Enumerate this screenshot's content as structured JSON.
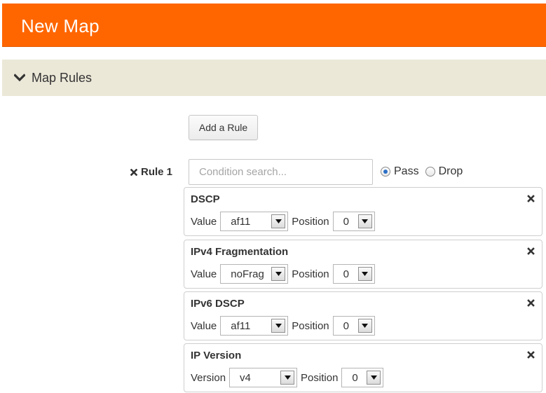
{
  "header": {
    "title": "New Map"
  },
  "section": {
    "title": "Map Rules",
    "chevron_icon": "chevron-down-icon"
  },
  "add_rule_button": "Add a Rule",
  "rule": {
    "label": "Rule 1",
    "condition_search": {
      "placeholder": "Condition search...",
      "value": ""
    },
    "action_options": [
      {
        "label": "Pass",
        "selected": true
      },
      {
        "label": "Drop",
        "selected": false
      }
    ]
  },
  "conditions": [
    {
      "title": "DSCP",
      "field_label": "Value",
      "field_value": "af11",
      "position_label": "Position",
      "position_value": "0"
    },
    {
      "title": "IPv4 Fragmentation",
      "field_label": "Value",
      "field_value": "noFrag",
      "position_label": "Position",
      "position_value": "0"
    },
    {
      "title": "IPv6 DSCP",
      "field_label": "Value",
      "field_value": "af11",
      "position_label": "Position",
      "position_value": "0"
    },
    {
      "title": "IP Version",
      "field_label": "Version",
      "field_value": "v4",
      "position_label": "Position",
      "position_value": "0"
    }
  ],
  "colors": {
    "header": "#ff6600",
    "section_bar": "#ece8d8",
    "radio_accent": "#2c6fc7"
  }
}
